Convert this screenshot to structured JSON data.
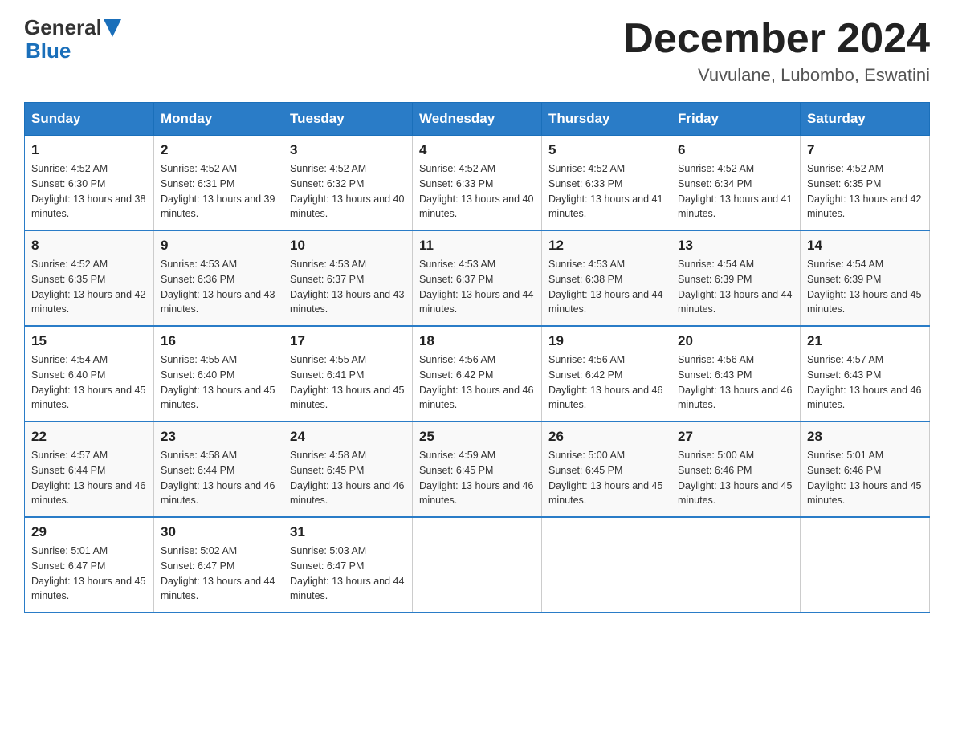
{
  "header": {
    "logo_general": "General",
    "logo_blue": "Blue",
    "month_title": "December 2024",
    "location": "Vuvulane, Lubombo, Eswatini"
  },
  "days_of_week": [
    "Sunday",
    "Monday",
    "Tuesday",
    "Wednesday",
    "Thursday",
    "Friday",
    "Saturday"
  ],
  "weeks": [
    [
      {
        "day": "1",
        "sunrise": "4:52 AM",
        "sunset": "6:30 PM",
        "daylight": "13 hours and 38 minutes."
      },
      {
        "day": "2",
        "sunrise": "4:52 AM",
        "sunset": "6:31 PM",
        "daylight": "13 hours and 39 minutes."
      },
      {
        "day": "3",
        "sunrise": "4:52 AM",
        "sunset": "6:32 PM",
        "daylight": "13 hours and 40 minutes."
      },
      {
        "day": "4",
        "sunrise": "4:52 AM",
        "sunset": "6:33 PM",
        "daylight": "13 hours and 40 minutes."
      },
      {
        "day": "5",
        "sunrise": "4:52 AM",
        "sunset": "6:33 PM",
        "daylight": "13 hours and 41 minutes."
      },
      {
        "day": "6",
        "sunrise": "4:52 AM",
        "sunset": "6:34 PM",
        "daylight": "13 hours and 41 minutes."
      },
      {
        "day": "7",
        "sunrise": "4:52 AM",
        "sunset": "6:35 PM",
        "daylight": "13 hours and 42 minutes."
      }
    ],
    [
      {
        "day": "8",
        "sunrise": "4:52 AM",
        "sunset": "6:35 PM",
        "daylight": "13 hours and 42 minutes."
      },
      {
        "day": "9",
        "sunrise": "4:53 AM",
        "sunset": "6:36 PM",
        "daylight": "13 hours and 43 minutes."
      },
      {
        "day": "10",
        "sunrise": "4:53 AM",
        "sunset": "6:37 PM",
        "daylight": "13 hours and 43 minutes."
      },
      {
        "day": "11",
        "sunrise": "4:53 AM",
        "sunset": "6:37 PM",
        "daylight": "13 hours and 44 minutes."
      },
      {
        "day": "12",
        "sunrise": "4:53 AM",
        "sunset": "6:38 PM",
        "daylight": "13 hours and 44 minutes."
      },
      {
        "day": "13",
        "sunrise": "4:54 AM",
        "sunset": "6:39 PM",
        "daylight": "13 hours and 44 minutes."
      },
      {
        "day": "14",
        "sunrise": "4:54 AM",
        "sunset": "6:39 PM",
        "daylight": "13 hours and 45 minutes."
      }
    ],
    [
      {
        "day": "15",
        "sunrise": "4:54 AM",
        "sunset": "6:40 PM",
        "daylight": "13 hours and 45 minutes."
      },
      {
        "day": "16",
        "sunrise": "4:55 AM",
        "sunset": "6:40 PM",
        "daylight": "13 hours and 45 minutes."
      },
      {
        "day": "17",
        "sunrise": "4:55 AM",
        "sunset": "6:41 PM",
        "daylight": "13 hours and 45 minutes."
      },
      {
        "day": "18",
        "sunrise": "4:56 AM",
        "sunset": "6:42 PM",
        "daylight": "13 hours and 46 minutes."
      },
      {
        "day": "19",
        "sunrise": "4:56 AM",
        "sunset": "6:42 PM",
        "daylight": "13 hours and 46 minutes."
      },
      {
        "day": "20",
        "sunrise": "4:56 AM",
        "sunset": "6:43 PM",
        "daylight": "13 hours and 46 minutes."
      },
      {
        "day": "21",
        "sunrise": "4:57 AM",
        "sunset": "6:43 PM",
        "daylight": "13 hours and 46 minutes."
      }
    ],
    [
      {
        "day": "22",
        "sunrise": "4:57 AM",
        "sunset": "6:44 PM",
        "daylight": "13 hours and 46 minutes."
      },
      {
        "day": "23",
        "sunrise": "4:58 AM",
        "sunset": "6:44 PM",
        "daylight": "13 hours and 46 minutes."
      },
      {
        "day": "24",
        "sunrise": "4:58 AM",
        "sunset": "6:45 PM",
        "daylight": "13 hours and 46 minutes."
      },
      {
        "day": "25",
        "sunrise": "4:59 AM",
        "sunset": "6:45 PM",
        "daylight": "13 hours and 46 minutes."
      },
      {
        "day": "26",
        "sunrise": "5:00 AM",
        "sunset": "6:45 PM",
        "daylight": "13 hours and 45 minutes."
      },
      {
        "day": "27",
        "sunrise": "5:00 AM",
        "sunset": "6:46 PM",
        "daylight": "13 hours and 45 minutes."
      },
      {
        "day": "28",
        "sunrise": "5:01 AM",
        "sunset": "6:46 PM",
        "daylight": "13 hours and 45 minutes."
      }
    ],
    [
      {
        "day": "29",
        "sunrise": "5:01 AM",
        "sunset": "6:47 PM",
        "daylight": "13 hours and 45 minutes."
      },
      {
        "day": "30",
        "sunrise": "5:02 AM",
        "sunset": "6:47 PM",
        "daylight": "13 hours and 44 minutes."
      },
      {
        "day": "31",
        "sunrise": "5:03 AM",
        "sunset": "6:47 PM",
        "daylight": "13 hours and 44 minutes."
      },
      null,
      null,
      null,
      null
    ]
  ]
}
